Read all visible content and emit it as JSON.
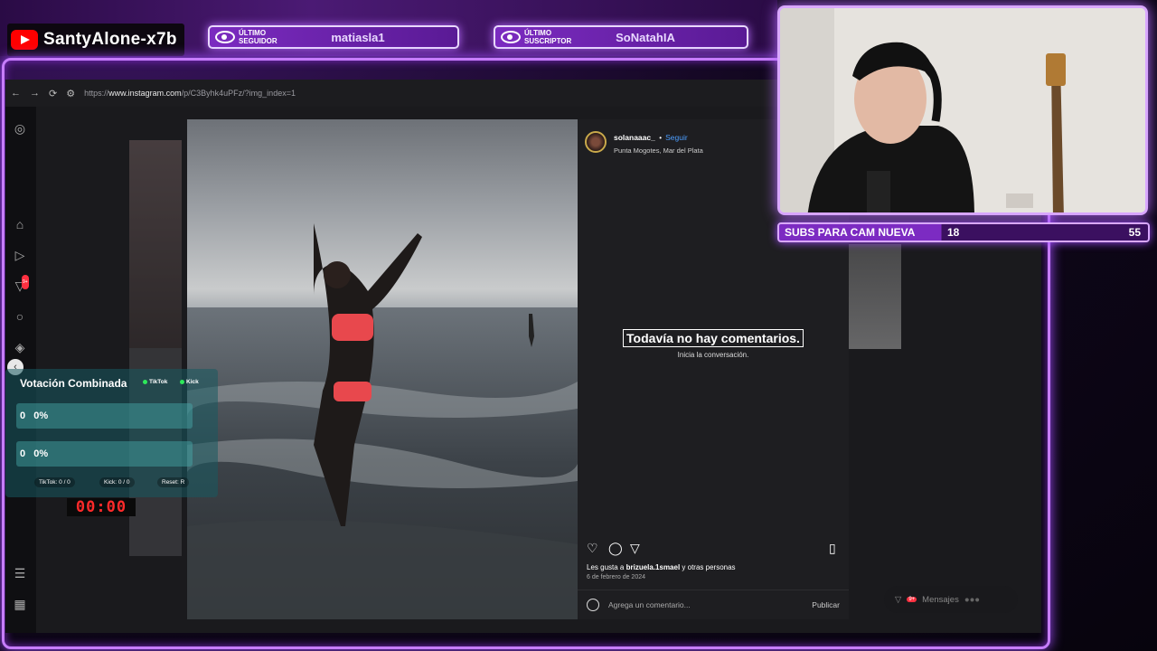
{
  "overlay": {
    "channel_name": "SantyAlone-x7b",
    "last_follower_label": "Último Seguidor",
    "last_follower": "matiasla1",
    "last_sub_label": "Último Suscriptor",
    "last_sub": "SoNatahIA"
  },
  "browser": {
    "url_prefix": "https://",
    "url_host": "www.instagram.com",
    "url_path": "/p/C3Byhk4uPFz/?img_index=1"
  },
  "post": {
    "username": "solanaaac_",
    "follow_label": "Seguir",
    "location": "Punta Mogotes, Mar del Plata",
    "no_comments_title": "Todavía no hay comentarios.",
    "no_comments_sub": "Inicia la conversación.",
    "likes_prefix": "Les gusta a ",
    "likes_user": "brizuela.1smael",
    "likes_suffix": " y otras personas",
    "date": "6 de febrero de 2024",
    "comment_placeholder": "Agrega un comentario...",
    "publish_label": "Publicar"
  },
  "messages": {
    "label": "Mensajes",
    "badge": "9+"
  },
  "notifications_badge": "9+",
  "subs_goal": {
    "label": "SUBS PARA CAM NUEVA",
    "current": "18",
    "goal": "55"
  },
  "vote": {
    "title": "Votación Combinada",
    "tag_tiktok": "TikTok",
    "tag_kick": "Kick",
    "row1": "0   0%",
    "row2": "0   0%",
    "foot_tiktok": "TikTok: 0 / 0",
    "foot_kick": "Kick: 0 / 0",
    "foot_reset": "Reset: R"
  },
  "timer": "00:00",
  "colors": {
    "accent": "#c77dff",
    "instagram_blue": "#4c9eff",
    "timer_red": "#ff2a2a"
  }
}
